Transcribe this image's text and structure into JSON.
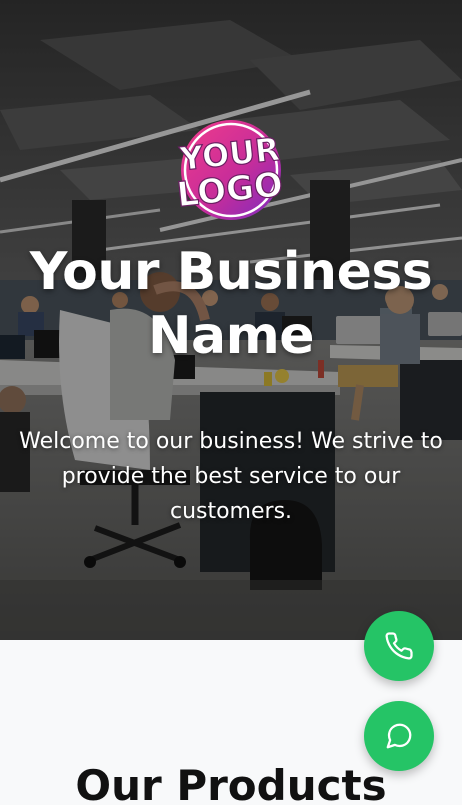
{
  "hero": {
    "business_name": "Your Business Name",
    "tagline": "Welcome to our business! We strive to provide the best service to our customers.",
    "logo": {
      "line1": "YOUR",
      "line2": "LOGO"
    }
  },
  "products": {
    "heading": "Our Products"
  },
  "floating_buttons": {
    "call_icon": "phone-icon",
    "chat_icon": "chat-bubble-icon",
    "color": "#25c466"
  },
  "colors": {
    "accent_green": "#25c466",
    "logo_magenta": "#d6267f",
    "logo_purple": "#7a2bc0",
    "section_bg": "#f8f9fa"
  }
}
